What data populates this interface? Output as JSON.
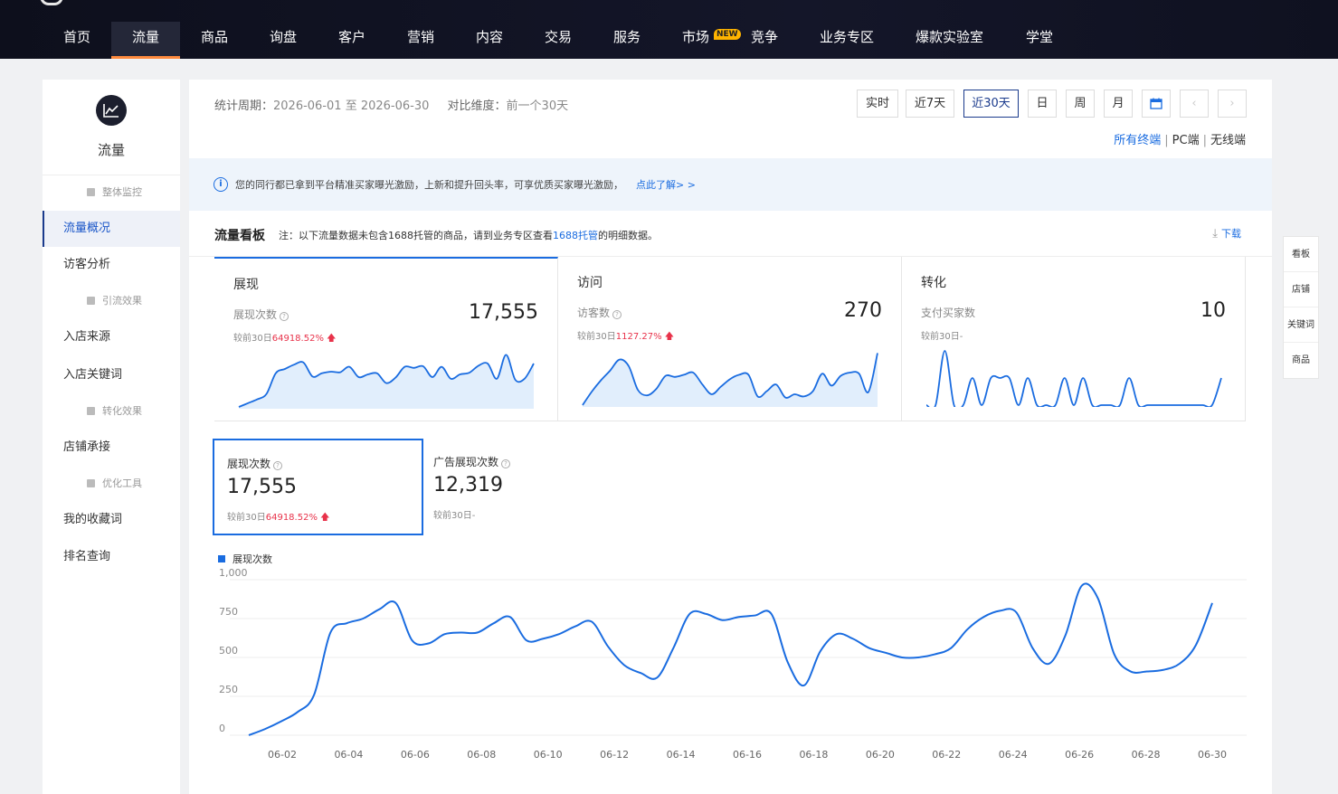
{
  "nav": {
    "items": [
      "首页",
      "流量",
      "商品",
      "询盘",
      "客户",
      "营销",
      "内容",
      "交易",
      "服务",
      "市场",
      "竞争",
      "业务专区",
      "爆款实验室",
      "学堂"
    ],
    "new_badge": "NEW"
  },
  "sidebar": {
    "title": "流量",
    "items": [
      {
        "label": "整体监控",
        "sub": true
      },
      {
        "label": "流量概况",
        "sub": false,
        "active": true
      },
      {
        "label": "访客分析",
        "sub": false
      },
      {
        "label": "引流效果",
        "sub": true
      },
      {
        "label": "入店来源",
        "sub": false
      },
      {
        "label": "入店关键词",
        "sub": false
      },
      {
        "label": "转化效果",
        "sub": true
      },
      {
        "label": "店铺承接",
        "sub": false
      },
      {
        "label": "优化工具",
        "sub": true
      },
      {
        "label": "我的收藏词",
        "sub": false
      },
      {
        "label": "排名查询",
        "sub": false
      }
    ]
  },
  "header": {
    "period_label": "统计周期：",
    "period_value": "2026-06-01 至 2026-06-30",
    "compare_label": "对比维度：",
    "compare_value": "前一个30天",
    "buttons": [
      "实时",
      "近7天",
      "近30天",
      "日",
      "周",
      "月"
    ],
    "active_button": "近30天",
    "terminals": {
      "all": "所有终端",
      "pc": "PC端",
      "wireless": "无线端",
      "sep": "|"
    }
  },
  "notice": {
    "icon": "i",
    "text": "您的同行都已拿到平台精准买家曝光激励，上新和提升回头率，可享优质买家曝光激励，",
    "link": "点此了解> >"
  },
  "board": {
    "title": "流量看板",
    "note_pre": "注：以下流量数据未包含1688托管的商品，请到业务专区查看",
    "note_link": "1688托管",
    "note_post": "的明细数据。",
    "download": "下载"
  },
  "cards": [
    {
      "title": "展现",
      "metric": "展现次数",
      "value": "17,555",
      "compare_label": "较前30日",
      "compare_value": "64918.52%",
      "up": true
    },
    {
      "title": "访问",
      "metric": "访客数",
      "value": "270",
      "compare_label": "较前30日",
      "compare_value": "1127.27%",
      "up": true
    },
    {
      "title": "转化",
      "metric": "支付买家数",
      "value": "10",
      "compare_label": "较前30日-",
      "compare_value": "",
      "up": false
    }
  ],
  "kpis": [
    {
      "label": "展现次数",
      "value": "17,555",
      "compare_label": "较前30日",
      "compare_value": "64918.52%",
      "up": true
    },
    {
      "label": "广告展现次数",
      "value": "12,319",
      "compare_label": "较前30日-",
      "compare_value": "",
      "up": false
    }
  ],
  "float_tabs": [
    "看板",
    "店铺",
    "关键词",
    "商品"
  ],
  "colors": {
    "accent": "#1a6ce0",
    "up": "#e8324a",
    "nav_bg": "#0d0f1c",
    "nav_active_underline": "#ff8a3d"
  },
  "chart_data": {
    "type": "line",
    "series": [
      {
        "name": "展现次数",
        "values": [
          0,
          40,
          90,
          150,
          260,
          660,
          720,
          750,
          810,
          850,
          610,
          590,
          650,
          660,
          660,
          720,
          760,
          610,
          620,
          650,
          700,
          730,
          570,
          450,
          400,
          370,
          560,
          780,
          780,
          740,
          760,
          770,
          780,
          470,
          320,
          540,
          650,
          620,
          560,
          530,
          500,
          500,
          520,
          560,
          680,
          760,
          800,
          790,
          560,
          460,
          640,
          960,
          880,
          520,
          410,
          410,
          420,
          460,
          580,
          850
        ]
      }
    ],
    "x_ticks": [
      "06-02",
      "06-04",
      "06-06",
      "06-08",
      "06-10",
      "06-12",
      "06-14",
      "06-16",
      "06-18",
      "06-20",
      "06-22",
      "06-24",
      "06-26",
      "06-28",
      "06-30"
    ],
    "y_ticks": [
      "0",
      "250",
      "500",
      "750",
      "1,000"
    ],
    "ylim": [
      0,
      1000
    ],
    "grid": true,
    "legend": "top-left"
  },
  "sparklines": [
    [
      0,
      0.07,
      0.14,
      0.24,
      0.62,
      0.7,
      0.78,
      0.82,
      0.56,
      0.62,
      0.65,
      0.64,
      0.74,
      0.55,
      0.6,
      0.62,
      0.44,
      0.54,
      0.74,
      0.72,
      0.75,
      0.55,
      0.74,
      0.52,
      0.6,
      0.63,
      0.76,
      0.8,
      0.52,
      0.96,
      0.5,
      0.52,
      0.8
    ],
    [
      0,
      0.25,
      0.46,
      0.64,
      0.84,
      0.72,
      0.28,
      0.18,
      0.3,
      0.54,
      0.52,
      0.56,
      0.6,
      0.38,
      0.2,
      0.34,
      0.48,
      0.56,
      0.56,
      0.16,
      0.26,
      0.38,
      0.14,
      0.2,
      0.16,
      0.26,
      0.58,
      0.36,
      0.54,
      0.6,
      0.58,
      0.24,
      0.96
    ],
    [
      0,
      0,
      1.0,
      0,
      0,
      0.5,
      0,
      0.5,
      0.5,
      0.5,
      0,
      0.5,
      0,
      0,
      0,
      0.5,
      0,
      0.5,
      0,
      0,
      0,
      0,
      0.5,
      0,
      0,
      0,
      0,
      0,
      0,
      0,
      0,
      0,
      0.5
    ]
  ]
}
